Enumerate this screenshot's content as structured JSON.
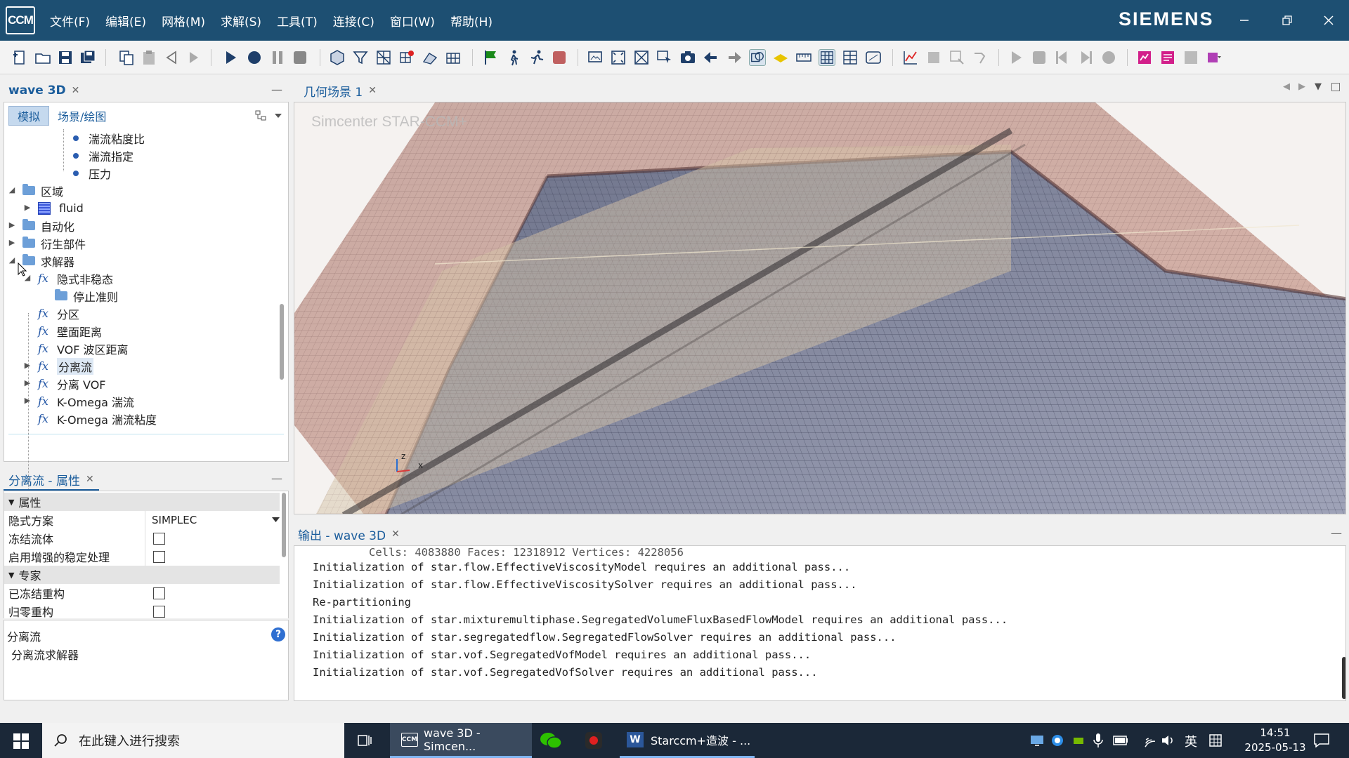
{
  "app": {
    "logo_text": "CCM",
    "brand": "SIEMENS",
    "menu": [
      "文件(F)",
      "编辑(E)",
      "网格(M)",
      "求解(S)",
      "工具(T)",
      "连接(C)",
      "窗口(W)",
      "帮助(H)"
    ]
  },
  "colors": {
    "titlebar": "#1d4f72",
    "accent": "#1b5d9c",
    "taskbar": "#1b2838"
  },
  "sim_panel": {
    "tab_label": "wave 3D",
    "subtabs": [
      "模拟",
      "场景/绘图"
    ],
    "tree": [
      {
        "label": "湍流粘度比",
        "icon": "dot"
      },
      {
        "label": "湍流指定",
        "icon": "dot"
      },
      {
        "label": "压力",
        "icon": "dot"
      },
      {
        "label": "区域",
        "icon": "folder"
      },
      {
        "label": "fluid",
        "icon": "grid"
      },
      {
        "label": "自动化",
        "icon": "folder"
      },
      {
        "label": "衍生部件",
        "icon": "folder"
      },
      {
        "label": "求解器",
        "icon": "folder"
      },
      {
        "label": "隐式非稳态",
        "icon": "fx"
      },
      {
        "label": "停止准则",
        "icon": "folder"
      },
      {
        "label": "分区",
        "icon": "fx"
      },
      {
        "label": "壁面距离",
        "icon": "fx"
      },
      {
        "label": "VOF 波区距离",
        "icon": "fx"
      },
      {
        "label": "分离流",
        "icon": "fx"
      },
      {
        "label": "分离 VOF",
        "icon": "fx"
      },
      {
        "label": "K-Omega 湍流",
        "icon": "fx"
      },
      {
        "label": "K-Omega 湍流粘度",
        "icon": "fx"
      }
    ]
  },
  "props_panel": {
    "tab_label": "分离流 - 属性",
    "section_props": "属性",
    "implicit_scheme_label": "隐式方案",
    "implicit_scheme_value": "SIMPLEC",
    "frozen_fluid_label": "冻结流体",
    "enhanced_stab_label": "启用增强的稳定处理",
    "section_expert": "专家",
    "frozen_restruct_label": "已冻结重构",
    "zero_restruct_label": "归零重构",
    "desc_title": "分离流",
    "desc_text": "分离流求解器"
  },
  "scene": {
    "tab_label": "几何场景 1",
    "watermark": "Simcenter STAR-CCM+",
    "axis_z": "z",
    "axis_x": "x"
  },
  "output": {
    "tab_label": "输出 - wave 3D",
    "lines": [
      "Cells: 4083880   Faces: 12318912  Vertices: 4228056",
      "Initialization of star.flow.EffectiveViscosityModel requires an additional pass...",
      "Initialization of star.flow.EffectiveViscositySolver requires an additional pass...",
      "Re-partitioning",
      "Initialization of star.mixturemultiphase.SegregatedVolumeFluxBasedFlowModel requires an additional pass...",
      "Initialization of star.segregatedflow.SegregatedFlowSolver requires an additional pass...",
      "Initialization of star.vof.SegregatedVofModel requires an additional pass...",
      "Initialization of star.vof.SegregatedVofSolver requires an additional pass..."
    ]
  },
  "taskbar": {
    "search_placeholder": "在此键入进行搜索",
    "app1_label": "wave 3D - Simcen...",
    "app1_icon": "CCM",
    "app2_label": "Starccm+造波 - ...",
    "app2_icon": "W",
    "ime": "英",
    "time": "14:51",
    "date": "2025-05-13"
  }
}
